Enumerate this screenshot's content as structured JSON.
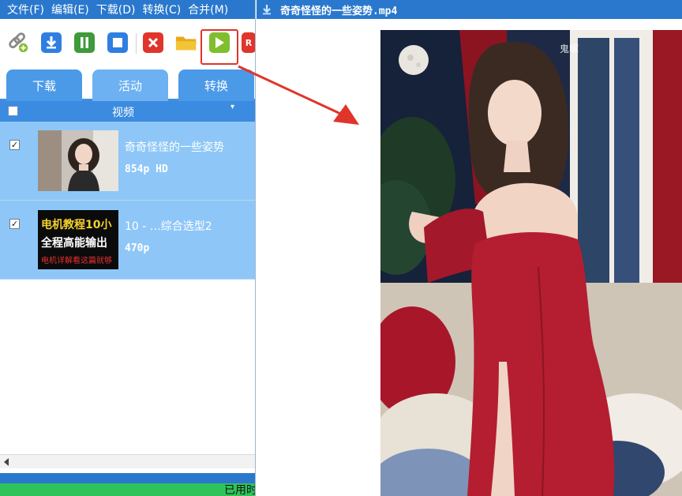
{
  "menu": [
    "文件(F)",
    "编辑(E)",
    "下载(D)",
    "转换(C)",
    "合并(M)"
  ],
  "toolbar": {
    "icons": [
      "link-add-icon",
      "download-icon",
      "pause-icon",
      "stop-icon",
      "delete-icon",
      "folder-icon",
      "play-icon",
      "record-icon"
    ],
    "colors": {
      "download": "#2f7fe0",
      "pause": "#3e9a3a",
      "stop": "#2f7fe0",
      "delete": "#e0352b",
      "play": "#7fbf2e",
      "folder": "#f4c437"
    }
  },
  "tabs": [
    "下载",
    "活动",
    "转换"
  ],
  "active_tab": "活动",
  "list": {
    "column_header": "视频",
    "items": [
      {
        "title": "奇奇怪怪的一些姿势",
        "meta": "854p HD",
        "checked": true,
        "thumb_type": "portrait"
      },
      {
        "title": "10 - …综合选型2",
        "meta": "470p",
        "checked": true,
        "thumb_type": "text-card",
        "thumb_line1": "电机教程10小",
        "thumb_line2": "全程高能输出",
        "thumb_line3": "电机详解看这篇就够"
      }
    ]
  },
  "status": {
    "text": "已用时"
  },
  "player": {
    "title": "奇奇怪怪的一些姿势.mp4",
    "watermark": "鬼塚"
  },
  "colors": {
    "accent": "#2a78cd",
    "row_bg": "#8ec7f7",
    "annotation": "#e0352b"
  }
}
